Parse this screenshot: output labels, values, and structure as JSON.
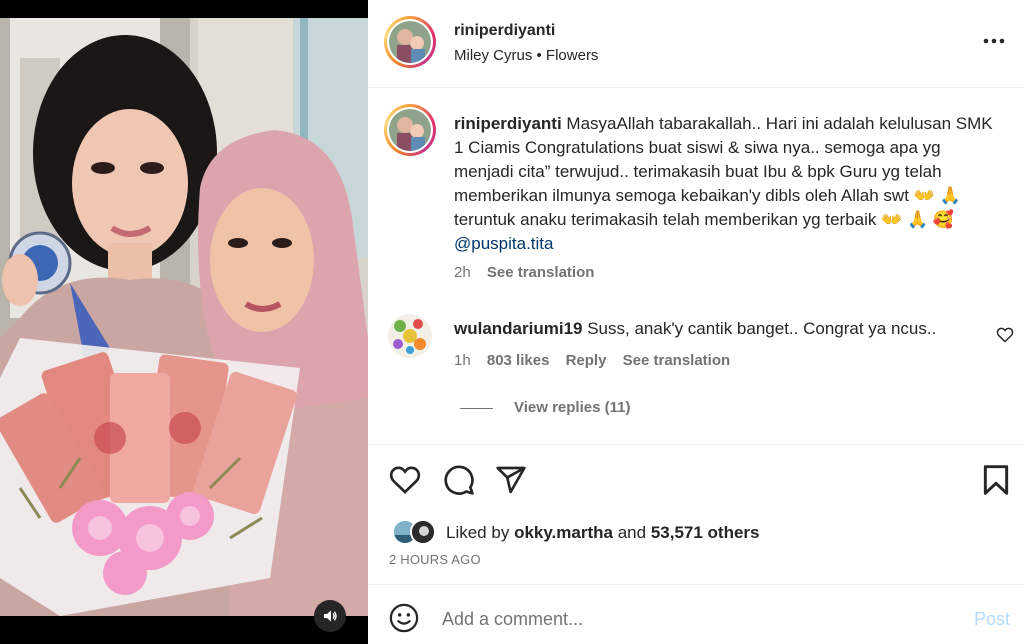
{
  "post": {
    "username": "riniperdiyanti",
    "audio": "Miley Cyrus • Flowers",
    "caption_text": "MasyaAllah tabarakallah.. Hari ini adalah kelulusan SMK 1 Ciamis Congratulations buat siswi & siwa nya.. semoga apa yg menjadi cita” terwujud.. terimakasih buat Ibu & bpk Guru yg telah memberikan ilmunya semoga kebaikan'y dibls oleh Allah swt 👐 🙏 teruntuk anaku terimakasih telah memberikan yg terbaik 👐 🙏 🥰",
    "caption_mention": "@puspita.tita",
    "caption_time": "2h",
    "see_translation": "See translation"
  },
  "comment": {
    "username": "wulandariumi19",
    "text": "Suss, anak'y cantik banget.. Congrat ya ncus..",
    "time": "1h",
    "likes": "803 likes",
    "reply": "Reply",
    "see_translation": "See translation",
    "view_replies": "View replies (11)"
  },
  "likes": {
    "prefix": "Liked by",
    "user": "okky.martha",
    "and": "and",
    "others": "53,571 others"
  },
  "timestamp": "2 HOURS AGO",
  "add_comment": {
    "placeholder": "Add a comment...",
    "post_label": "Post"
  },
  "colors": {
    "text": "#262626",
    "secondary": "#737373",
    "mention": "#00376b",
    "post_disabled": "#b3dbff",
    "divider": "#efefef"
  },
  "icons": [
    "more-icon",
    "heart-icon",
    "comment-icon",
    "share-icon",
    "bookmark-icon",
    "emoji-icon",
    "sound-icon",
    "small-heart-icon"
  ]
}
